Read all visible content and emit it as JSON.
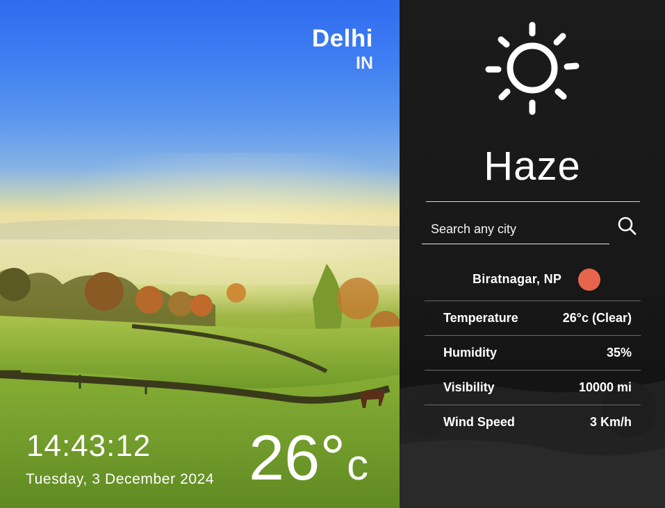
{
  "location": {
    "city": "Delhi",
    "country": "IN"
  },
  "time": {
    "clock": "14:43:12",
    "date": "Tuesday, 3 December 2024"
  },
  "current": {
    "temperature": "26",
    "degree_symbol": "°",
    "unit": "c",
    "condition": "Haze",
    "condition_icon": "sun-icon"
  },
  "search": {
    "placeholder": "Search any city",
    "value": "",
    "button_icon": "search-icon"
  },
  "searched_location": {
    "name": "Biratnagar, NP",
    "indicator_color": "#e8654d"
  },
  "stats": [
    {
      "label": "Temperature",
      "value": "26°c (Clear)"
    },
    {
      "label": "Humidity",
      "value": "35%"
    },
    {
      "label": "Visibility",
      "value": "10000 mi"
    },
    {
      "label": "Wind Speed",
      "value": "3 Km/h"
    }
  ],
  "colors": {
    "panel_bg": "#181818",
    "accent": "#e8654d",
    "sky": "#2f6cf0"
  }
}
